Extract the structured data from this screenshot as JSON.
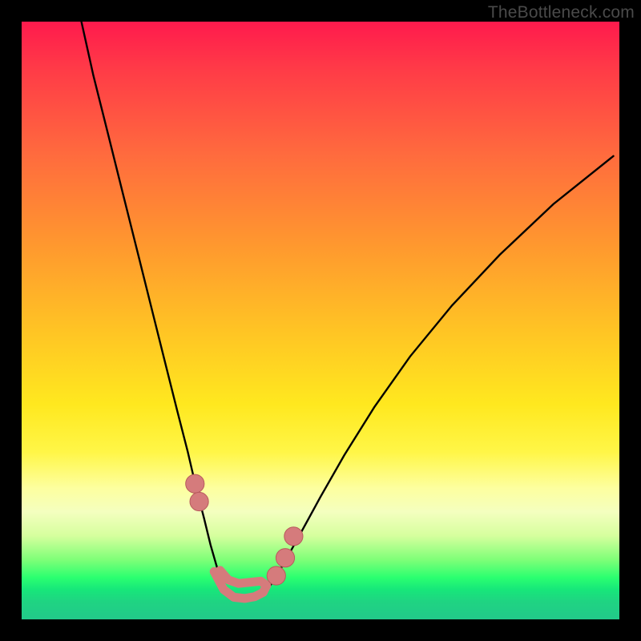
{
  "watermark": "TheBottleneck.com",
  "colors": {
    "frame": "#000000",
    "gradient_top": "#ff1a4d",
    "gradient_mid1": "#ff9a2e",
    "gradient_mid2": "#ffe81f",
    "gradient_bottom": "#22c98a",
    "curve_stroke": "#000000",
    "marker_fill": "#d57b7c",
    "marker_stroke": "#b85a5d"
  },
  "chart_data": {
    "type": "line",
    "title": "",
    "xlabel": "",
    "ylabel": "",
    "xlim": [
      0,
      100
    ],
    "ylim": [
      0,
      100
    ],
    "note": "x,y in percent of plot area; y=0 is top, y=100 is bottom (screen coords).",
    "series": [
      {
        "name": "left-branch",
        "x": [
          10.0,
          12.0,
          14.5,
          17.0,
          19.5,
          22.0,
          24.0,
          26.0,
          27.8,
          29.2,
          30.5,
          31.6,
          32.6,
          33.4,
          34.0
        ],
        "y": [
          0.0,
          9.0,
          19.0,
          29.0,
          39.0,
          49.0,
          57.0,
          65.0,
          72.0,
          78.0,
          83.0,
          87.5,
          91.0,
          93.5,
          95.0
        ]
      },
      {
        "name": "valley-floor",
        "x": [
          34.0,
          35.0,
          36.5,
          38.0,
          39.5,
          41.0
        ],
        "y": [
          95.0,
          96.2,
          96.8,
          96.8,
          96.3,
          95.2
        ]
      },
      {
        "name": "right-branch",
        "x": [
          41.0,
          42.5,
          44.5,
          47.0,
          50.0,
          54.0,
          59.0,
          65.0,
          72.0,
          80.0,
          89.0,
          99.0
        ],
        "y": [
          95.2,
          93.0,
          89.5,
          85.0,
          79.5,
          72.5,
          64.5,
          56.0,
          47.5,
          39.0,
          30.5,
          22.5
        ]
      }
    ],
    "markers": [
      {
        "name": "left-dot-1",
        "x": 29.0,
        "y": 77.3,
        "r": 1.55
      },
      {
        "name": "left-dot-2",
        "x": 29.7,
        "y": 80.3,
        "r": 1.55
      },
      {
        "name": "floor-blob-start",
        "x": 33.0,
        "y": 93.3,
        "r": 1.7
      },
      {
        "name": "floor-blob-end",
        "x": 40.0,
        "y": 96.0,
        "r": 1.7
      },
      {
        "name": "right-dot-1",
        "x": 42.6,
        "y": 92.7,
        "r": 1.55
      },
      {
        "name": "right-dot-2",
        "x": 44.1,
        "y": 89.7,
        "r": 1.55
      },
      {
        "name": "right-dot-3",
        "x": 45.5,
        "y": 86.1,
        "r": 1.55
      }
    ],
    "floor_blob": {
      "path_pct": [
        [
          32.2,
          92.0
        ],
        [
          33.8,
          95.0
        ],
        [
          35.5,
          96.3
        ],
        [
          37.3,
          96.5
        ],
        [
          39.0,
          96.2
        ],
        [
          40.4,
          95.5
        ],
        [
          41.0,
          94.3
        ],
        [
          40.0,
          93.6
        ],
        [
          38.2,
          93.8
        ],
        [
          36.3,
          94.0
        ],
        [
          34.6,
          93.4
        ],
        [
          33.2,
          91.8
        ]
      ]
    }
  }
}
